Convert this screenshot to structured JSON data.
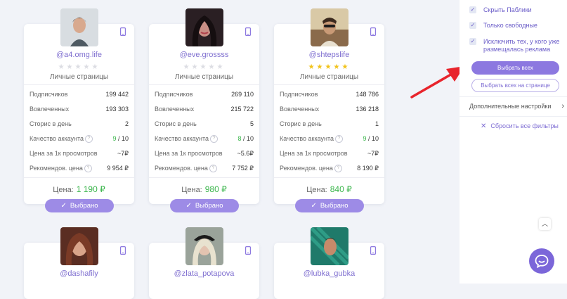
{
  "cards": [
    {
      "handle": "@a4.omg.life",
      "stars_filled": 0,
      "stars_total": 5,
      "category": "Личные страницы",
      "stats": [
        {
          "label": "Подписчиков",
          "value": "199 442"
        },
        {
          "label": "Вовлеченных",
          "value": "193 303"
        },
        {
          "label": "Сторис в день",
          "value": "2"
        },
        {
          "label": "Качество аккаунта",
          "value_num": "9",
          "value_den": " / 10"
        },
        {
          "label": "Цена за 1к просмотров",
          "value": "~7₽"
        },
        {
          "label": "Рекомендов. цена",
          "value": "9 954 ₽"
        }
      ],
      "price_label": "Цена:",
      "price_value": "1 190 ₽",
      "select_label": "Выбрано"
    },
    {
      "handle": "@eve.grossss",
      "stars_filled": 0,
      "stars_total": 5,
      "category": "Личные страницы",
      "stats": [
        {
          "label": "Подписчиков",
          "value": "269 110"
        },
        {
          "label": "Вовлеченных",
          "value": "215 722"
        },
        {
          "label": "Сторис в день",
          "value": "5"
        },
        {
          "label": "Качество аккаунта",
          "value_num": "8",
          "value_den": " / 10"
        },
        {
          "label": "Цена за 1к просмотров",
          "value": "~5.6₽"
        },
        {
          "label": "Рекомендов. цена",
          "value": "7 752 ₽"
        }
      ],
      "price_label": "Цена:",
      "price_value": "980 ₽",
      "select_label": "Выбрано"
    },
    {
      "handle": "@shtepslife",
      "stars_filled": 5,
      "stars_total": 5,
      "category": "Личные страницы",
      "stats": [
        {
          "label": "Подписчиков",
          "value": "148 786"
        },
        {
          "label": "Вовлеченных",
          "value": "136 218"
        },
        {
          "label": "Сторис в день",
          "value": "1"
        },
        {
          "label": "Качество аккаунта",
          "value_num": "9",
          "value_den": " / 10"
        },
        {
          "label": "Цена за 1к просмотров",
          "value": "~7₽"
        },
        {
          "label": "Рекомендов. цена",
          "value": "8 190 ₽"
        }
      ],
      "price_label": "Цена:",
      "price_value": "840 ₽",
      "select_label": "Выбрано"
    },
    {
      "handle": "@dashafily"
    },
    {
      "handle": "@zlata_potapova"
    },
    {
      "handle": "@lubka_gubka"
    }
  ],
  "sidebar": {
    "checkboxes": [
      {
        "label": "Скрыть Паблики",
        "checked": true
      },
      {
        "label": "Только свободные",
        "checked": true
      },
      {
        "label": "Исключить тех, у кого уже размещалась реклама",
        "checked": true
      }
    ],
    "select_all_label": "Выбрать всех",
    "select_all_page_label": "Выбрать всех на странице",
    "more_settings_label": "Дополнительные настройки",
    "reset_label": "Сбросить все фильтры"
  },
  "colors": {
    "accent": "#8c78e0",
    "price_green": "#39b54a",
    "star": "#f2c31a",
    "arrow": "#e8242c"
  }
}
